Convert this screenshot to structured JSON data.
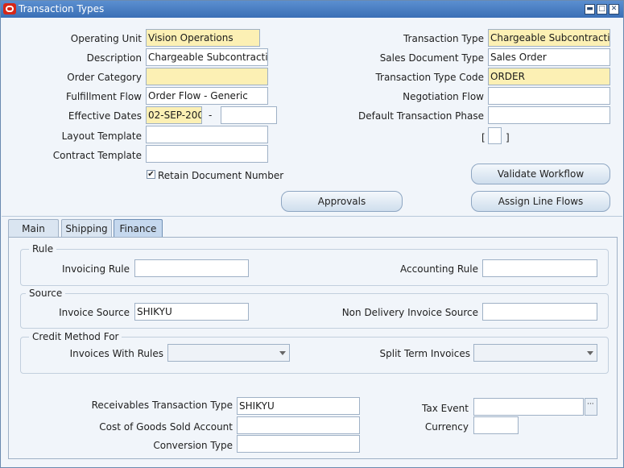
{
  "window": {
    "title": "Transaction Types"
  },
  "header": {
    "operating_unit_label": "Operating Unit",
    "operating_unit_value": "Vision Operations",
    "description_label": "Description",
    "description_value": "Chargeable Subcontractin",
    "order_category_label": "Order Category",
    "order_category_value": "",
    "fulfillment_flow_label": "Fulfillment Flow",
    "fulfillment_flow_value": "Order Flow - Generic",
    "effective_dates_label": "Effective Dates",
    "effective_date_from": "02-SEP-200",
    "effective_date_dash": "-",
    "effective_date_to": "",
    "layout_template_label": "Layout Template",
    "layout_template_value": "",
    "contract_template_label": "Contract Template",
    "contract_template_value": "",
    "retain_doc_label": "Retain Document Number",
    "retain_doc_checked": "✔",
    "transaction_type_label": "Transaction Type",
    "transaction_type_value": "Chargeable Subcontractin",
    "sales_doc_type_label": "Sales Document Type",
    "sales_doc_type_value": "Sales Order",
    "trx_type_code_label": "Transaction Type Code",
    "trx_type_code_value": "ORDER",
    "negotiation_flow_label": "Negotiation Flow",
    "negotiation_flow_value": "",
    "default_phase_label": "Default Transaction Phase",
    "default_phase_value": "",
    "bracket_open": "[",
    "bracket_close": "]"
  },
  "buttons": {
    "validate_workflow": "Validate Workflow",
    "approvals": "Approvals",
    "assign_line_flows": "Assign Line  Flows"
  },
  "tabs": [
    {
      "label": "Main"
    },
    {
      "label": "Shipping"
    },
    {
      "label": "Finance"
    }
  ],
  "finance": {
    "rule_title": "Rule",
    "invoicing_rule_label": "Invoicing Rule",
    "invoicing_rule_value": "",
    "accounting_rule_label": "Accounting Rule",
    "accounting_rule_value": "",
    "source_title": "Source",
    "invoice_source_label": "Invoice Source",
    "invoice_source_value": "SHIKYU",
    "non_delivery_label": "Non Delivery Invoice Source",
    "non_delivery_value": "",
    "credit_title": "Credit Method For",
    "invoices_with_rules_label": "Invoices With Rules",
    "invoices_with_rules_value": "",
    "split_term_label": "Split Term Invoices",
    "split_term_value": "",
    "receivables_trx_type_label": "Receivables Transaction Type",
    "receivables_trx_type_value": "SHIKYU",
    "cogs_account_label": "Cost of Goods Sold Account",
    "cogs_account_value": "",
    "conversion_type_label": "Conversion Type",
    "conversion_type_value": "",
    "tax_event_label": "Tax Event",
    "tax_event_value": "",
    "currency_label": "Currency",
    "currency_value": "",
    "lov_glyph": "···"
  }
}
